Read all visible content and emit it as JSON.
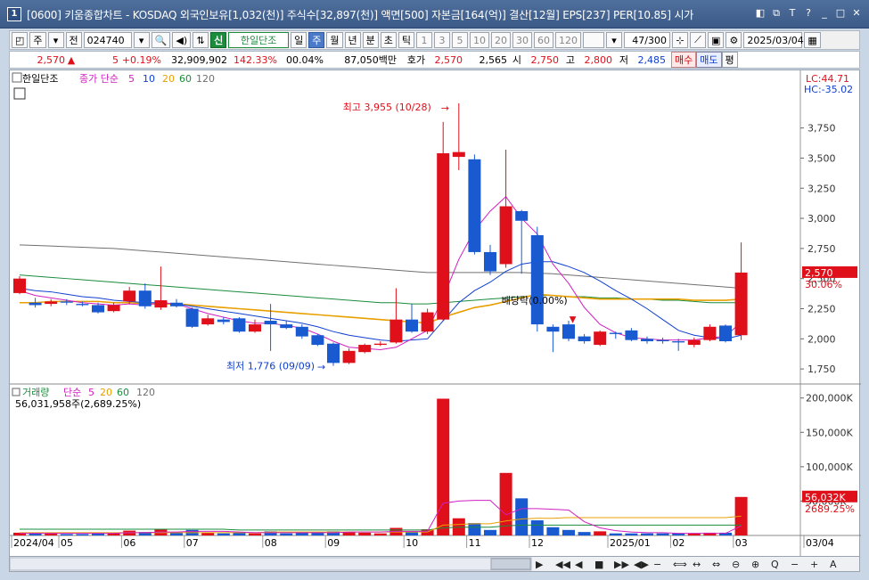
{
  "window": {
    "number": "1",
    "title": "[0600] 키움종합차트 - KOSDAQ 외국인보유[1,032(천)] 주식수[32,897(천)] 액면[500] 자본금[164(억)] 결산[12월] EPS[237] PER[10.85] 시가",
    "buttons": [
      "◧",
      "⧉",
      "T",
      "?",
      "_",
      "□",
      "✕"
    ]
  },
  "toolbar": {
    "period_label": "주",
    "prev_label": "전",
    "code": "024740",
    "badge": "신",
    "stock_name": "한일단조",
    "intervals": [
      "일",
      "주",
      "월",
      "년",
      "분",
      "초",
      "틱"
    ],
    "active_interval": "주",
    "numbers": [
      "1",
      "3",
      "5",
      "10",
      "20",
      "30",
      "60",
      "120"
    ],
    "count": "47/300",
    "date": "2025/03/04"
  },
  "quote": {
    "price": "2,570",
    "arrow": "▲",
    "change": "5",
    "change_pct": "+0.19%",
    "volume": "32,909,902",
    "vol_ratio": "142.33%",
    "turnover": "00.04%",
    "amount": "87,050백만",
    "ask_label": "호가",
    "ask1": "2,570",
    "bid1": "2,565",
    "open_label": "시",
    "open": "2,750",
    "high_label": "고",
    "high": "2,800",
    "low_label": "저",
    "low": "2,485",
    "buy": "매수",
    "sell": "매도",
    "eval": "평"
  },
  "price_panel": {
    "legend_name": "한일단조",
    "legend_ma": "종가 단순",
    "ma_periods": [
      "5",
      "10",
      "20",
      "60",
      "120"
    ],
    "ma_colors": [
      "#d020c0",
      "#1040d0",
      "#e8a000",
      "#1a8c3c",
      "#707070"
    ],
    "lc": "LC:44.71",
    "hc": "HC:-35.02",
    "price_tag": "2,570",
    "pct_tag": "30.06%",
    "high_annot": "최고 3,955 (10/28)",
    "low_annot": "최저 1,776 (09/09)",
    "dividend_annot": "배당락(0.00%)"
  },
  "volume_panel": {
    "legend_name": "거래량",
    "legend_ma": "단순",
    "ma_periods": [
      "5",
      "20",
      "60",
      "120"
    ],
    "summary": "56,031,958주(2,689.25%)",
    "tag_value": "56,032K",
    "tag_pct": "2689.25%"
  },
  "chart_data": {
    "type": "candlestick",
    "price_axis": [
      "3,750",
      "3,500",
      "3,250",
      "3,000",
      "2,750",
      "2,500",
      "2,250",
      "2,000",
      "1,750"
    ],
    "ylim": [
      1640,
      4080
    ],
    "volume_axis": [
      "200,000K",
      "150,000K",
      "100,000K",
      "50,000K"
    ],
    "vol_ylim": [
      0,
      210000
    ],
    "x_labels": [
      "2024/04",
      "05",
      "06",
      "07",
      "08",
      "09",
      "10",
      "11",
      "12",
      "2025/01",
      "02",
      "03",
      "03/04"
    ],
    "x_label_idx": [
      0,
      3,
      7,
      11,
      16,
      20,
      25,
      29,
      33,
      38,
      42,
      46,
      50
    ],
    "candles": [
      {
        "o": 2380,
        "c": 2500,
        "h": 2520,
        "l": 2370,
        "v": 4000
      },
      {
        "o": 2300,
        "c": 2280,
        "h": 2340,
        "l": 2260,
        "v": 3000
      },
      {
        "o": 2290,
        "c": 2310,
        "h": 2330,
        "l": 2270,
        "v": 3000
      },
      {
        "o": 2310,
        "c": 2300,
        "h": 2330,
        "l": 2280,
        "v": 2000
      },
      {
        "o": 2290,
        "c": 2280,
        "h": 2310,
        "l": 2270,
        "v": 2000
      },
      {
        "o": 2280,
        "c": 2220,
        "h": 2300,
        "l": 2210,
        "v": 3000
      },
      {
        "o": 2230,
        "c": 2280,
        "h": 2300,
        "l": 2220,
        "v": 3000
      },
      {
        "o": 2310,
        "c": 2400,
        "h": 2430,
        "l": 2290,
        "v": 7000
      },
      {
        "o": 2400,
        "c": 2270,
        "h": 2460,
        "l": 2250,
        "v": 5000
      },
      {
        "o": 2260,
        "c": 2320,
        "h": 2600,
        "l": 2240,
        "v": 9000
      },
      {
        "o": 2300,
        "c": 2270,
        "h": 2330,
        "l": 2260,
        "v": 4000
      },
      {
        "o": 2250,
        "c": 2100,
        "h": 2260,
        "l": 2090,
        "v": 8000
      },
      {
        "o": 2120,
        "c": 2170,
        "h": 2200,
        "l": 2110,
        "v": 4000
      },
      {
        "o": 2160,
        "c": 2140,
        "h": 2180,
        "l": 2120,
        "v": 3000
      },
      {
        "o": 2170,
        "c": 2060,
        "h": 2180,
        "l": 2050,
        "v": 4000
      },
      {
        "o": 2060,
        "c": 2120,
        "h": 2160,
        "l": 2050,
        "v": 3000
      },
      {
        "o": 2150,
        "c": 2120,
        "h": 2290,
        "l": 1900,
        "v": 6000
      },
      {
        "o": 2120,
        "c": 2090,
        "h": 2150,
        "l": 2080,
        "v": 3000
      },
      {
        "o": 2100,
        "c": 2020,
        "h": 2120,
        "l": 2000,
        "v": 4000
      },
      {
        "o": 2030,
        "c": 1950,
        "h": 2040,
        "l": 1940,
        "v": 5000
      },
      {
        "o": 1960,
        "c": 1800,
        "h": 1970,
        "l": 1776,
        "v": 6000
      },
      {
        "o": 1800,
        "c": 1900,
        "h": 1920,
        "l": 1790,
        "v": 5000
      },
      {
        "o": 1890,
        "c": 1950,
        "h": 1960,
        "l": 1880,
        "v": 4000
      },
      {
        "o": 1950,
        "c": 1960,
        "h": 1980,
        "l": 1940,
        "v": 3000
      },
      {
        "o": 1970,
        "c": 2160,
        "h": 2420,
        "l": 1960,
        "v": 11000
      },
      {
        "o": 2160,
        "c": 2060,
        "h": 2290,
        "l": 2050,
        "v": 5000
      },
      {
        "o": 2060,
        "c": 2220,
        "h": 2250,
        "l": 2040,
        "v": 9000
      },
      {
        "o": 2160,
        "c": 3540,
        "h": 3800,
        "l": 2150,
        "v": 199000
      },
      {
        "o": 3510,
        "c": 3550,
        "h": 3955,
        "l": 3400,
        "v": 25000
      },
      {
        "o": 3490,
        "c": 2720,
        "h": 3530,
        "l": 2700,
        "v": 18000
      },
      {
        "o": 2720,
        "c": 2560,
        "h": 2780,
        "l": 2530,
        "v": 8000
      },
      {
        "o": 2620,
        "c": 3100,
        "h": 3570,
        "l": 2590,
        "v": 91000
      },
      {
        "o": 3060,
        "c": 2980,
        "h": 3070,
        "l": 2540,
        "v": 54000
      },
      {
        "o": 2860,
        "c": 2120,
        "h": 2930,
        "l": 2060,
        "v": 22000
      },
      {
        "o": 2100,
        "c": 2060,
        "h": 2120,
        "l": 1890,
        "v": 12000
      },
      {
        "o": 2120,
        "c": 2000,
        "h": 2150,
        "l": 1980,
        "v": 8000
      },
      {
        "o": 2020,
        "c": 1980,
        "h": 2040,
        "l": 1960,
        "v": 5000
      },
      {
        "o": 1950,
        "c": 2060,
        "h": 2070,
        "l": 1940,
        "v": 6000
      },
      {
        "o": 2050,
        "c": 2040,
        "h": 2060,
        "l": 2000,
        "v": 3000
      },
      {
        "o": 2070,
        "c": 1990,
        "h": 2090,
        "l": 1980,
        "v": 3000
      },
      {
        "o": 2000,
        "c": 1980,
        "h": 2020,
        "l": 1960,
        "v": 3000
      },
      {
        "o": 1990,
        "c": 1980,
        "h": 2010,
        "l": 1960,
        "v": 3000
      },
      {
        "o": 1980,
        "c": 1970,
        "h": 2000,
        "l": 1900,
        "v": 3000
      },
      {
        "o": 1950,
        "c": 1990,
        "h": 2010,
        "l": 1930,
        "v": 3000
      },
      {
        "o": 1990,
        "c": 2100,
        "h": 2120,
        "l": 1980,
        "v": 4000
      },
      {
        "o": 2110,
        "c": 1980,
        "h": 2120,
        "l": 1970,
        "v": 4000
      },
      {
        "o": 2030,
        "c": 2550,
        "h": 2800,
        "l": 1990,
        "v": 56032
      }
    ],
    "ma5": [
      2400,
      2360,
      2340,
      2320,
      2300,
      2290,
      2280,
      2290,
      2280,
      2300,
      2290,
      2250,
      2210,
      2180,
      2150,
      2130,
      2130,
      2110,
      2090,
      2040,
      1980,
      1930,
      1920,
      1910,
      1930,
      2000,
      2070,
      2340,
      2660,
      2900,
      3060,
      3180,
      3000,
      2870,
      2620,
      2460,
      2260,
      2120,
      2050,
      2010,
      2000,
      1990,
      1990,
      1990,
      2010,
      2020,
      2140
    ],
    "ma10": [
      2420,
      2400,
      2390,
      2370,
      2350,
      2340,
      2320,
      2310,
      2300,
      2300,
      2290,
      2270,
      2250,
      2230,
      2210,
      2190,
      2170,
      2150,
      2130,
      2100,
      2060,
      2030,
      2010,
      1990,
      1980,
      1990,
      2000,
      2150,
      2300,
      2400,
      2470,
      2560,
      2620,
      2640,
      2640,
      2600,
      2550,
      2480,
      2400,
      2330,
      2250,
      2160,
      2070,
      2030,
      2010,
      2000,
      2030
    ],
    "ma20": [
      2300,
      2300,
      2310,
      2310,
      2310,
      2310,
      2300,
      2300,
      2290,
      2290,
      2290,
      2280,
      2270,
      2260,
      2250,
      2240,
      2230,
      2220,
      2210,
      2200,
      2190,
      2180,
      2170,
      2160,
      2150,
      2140,
      2130,
      2180,
      2220,
      2260,
      2280,
      2310,
      2340,
      2370,
      2360,
      2350,
      2340,
      2330,
      2330,
      2330,
      2330,
      2330,
      2330,
      2320,
      2320,
      2320,
      2330
    ],
    "ma60": [
      2530,
      2520,
      2510,
      2500,
      2490,
      2480,
      2470,
      2460,
      2450,
      2440,
      2430,
      2420,
      2410,
      2400,
      2390,
      2380,
      2370,
      2360,
      2350,
      2340,
      2330,
      2320,
      2310,
      2300,
      2300,
      2290,
      2290,
      2300,
      2310,
      2320,
      2330,
      2340,
      2350,
      2360,
      2360,
      2350,
      2350,
      2340,
      2340,
      2330,
      2330,
      2320,
      2320,
      2310,
      2300,
      2300,
      2300
    ],
    "ma120": [
      2780,
      2775,
      2770,
      2765,
      2760,
      2755,
      2750,
      2740,
      2730,
      2720,
      2710,
      2700,
      2690,
      2680,
      2670,
      2660,
      2650,
      2640,
      2630,
      2620,
      2610,
      2600,
      2590,
      2580,
      2570,
      2560,
      2550,
      2550,
      2550,
      2550,
      2550,
      2550,
      2550,
      2545,
      2540,
      2530,
      2520,
      2510,
      2500,
      2490,
      2480,
      2470,
      2460,
      2450,
      2440,
      2430,
      2420
    ],
    "vma5": [
      3000,
      3000,
      3000,
      3000,
      3000,
      3000,
      3000,
      4000,
      4000,
      5000,
      5000,
      6000,
      6000,
      6000,
      5000,
      4000,
      4000,
      4000,
      4000,
      4000,
      4000,
      5000,
      5000,
      5000,
      6000,
      6000,
      6000,
      47000,
      50000,
      51000,
      51000,
      30000,
      39000,
      39000,
      38000,
      37000,
      20000,
      11000,
      7000,
      5000,
      4000,
      4000,
      3000,
      3000,
      3000,
      3000,
      14000
    ],
    "vma20": [
      4000,
      4000,
      4000,
      4000,
      4000,
      4000,
      4000,
      4000,
      4000,
      4000,
      4000,
      4000,
      4000,
      4000,
      4000,
      4000,
      5000,
      5000,
      5000,
      5000,
      5000,
      5000,
      5000,
      5000,
      5000,
      5000,
      5000,
      15000,
      16000,
      17000,
      17000,
      21000,
      24000,
      25000,
      25000,
      26000,
      26000,
      26000,
      26000,
      26000,
      26000,
      26000,
      26000,
      26000,
      26000,
      26000,
      28000
    ],
    "vma60": [
      9000,
      9000,
      9000,
      9000,
      9000,
      9000,
      9000,
      9000,
      9000,
      9000,
      9000,
      9000,
      9000,
      9000,
      8000,
      8000,
      8000,
      8000,
      8000,
      8000,
      8000,
      8000,
      8000,
      8000,
      8000,
      8000,
      8000,
      11000,
      12000,
      12000,
      12000,
      14000,
      15000,
      15000,
      15000,
      15000,
      15000,
      15000,
      15000,
      15000,
      15000,
      15000,
      15000,
      15000,
      15000,
      15000,
      15000
    ]
  },
  "bottom_icons": [
    "▶",
    "◀◀",
    "◀",
    "■",
    "▶▶",
    "◀▶",
    "−",
    "⟺",
    "↔",
    "⇔",
    "⊖",
    "⊕",
    "Q",
    "−",
    "+",
    "A"
  ]
}
